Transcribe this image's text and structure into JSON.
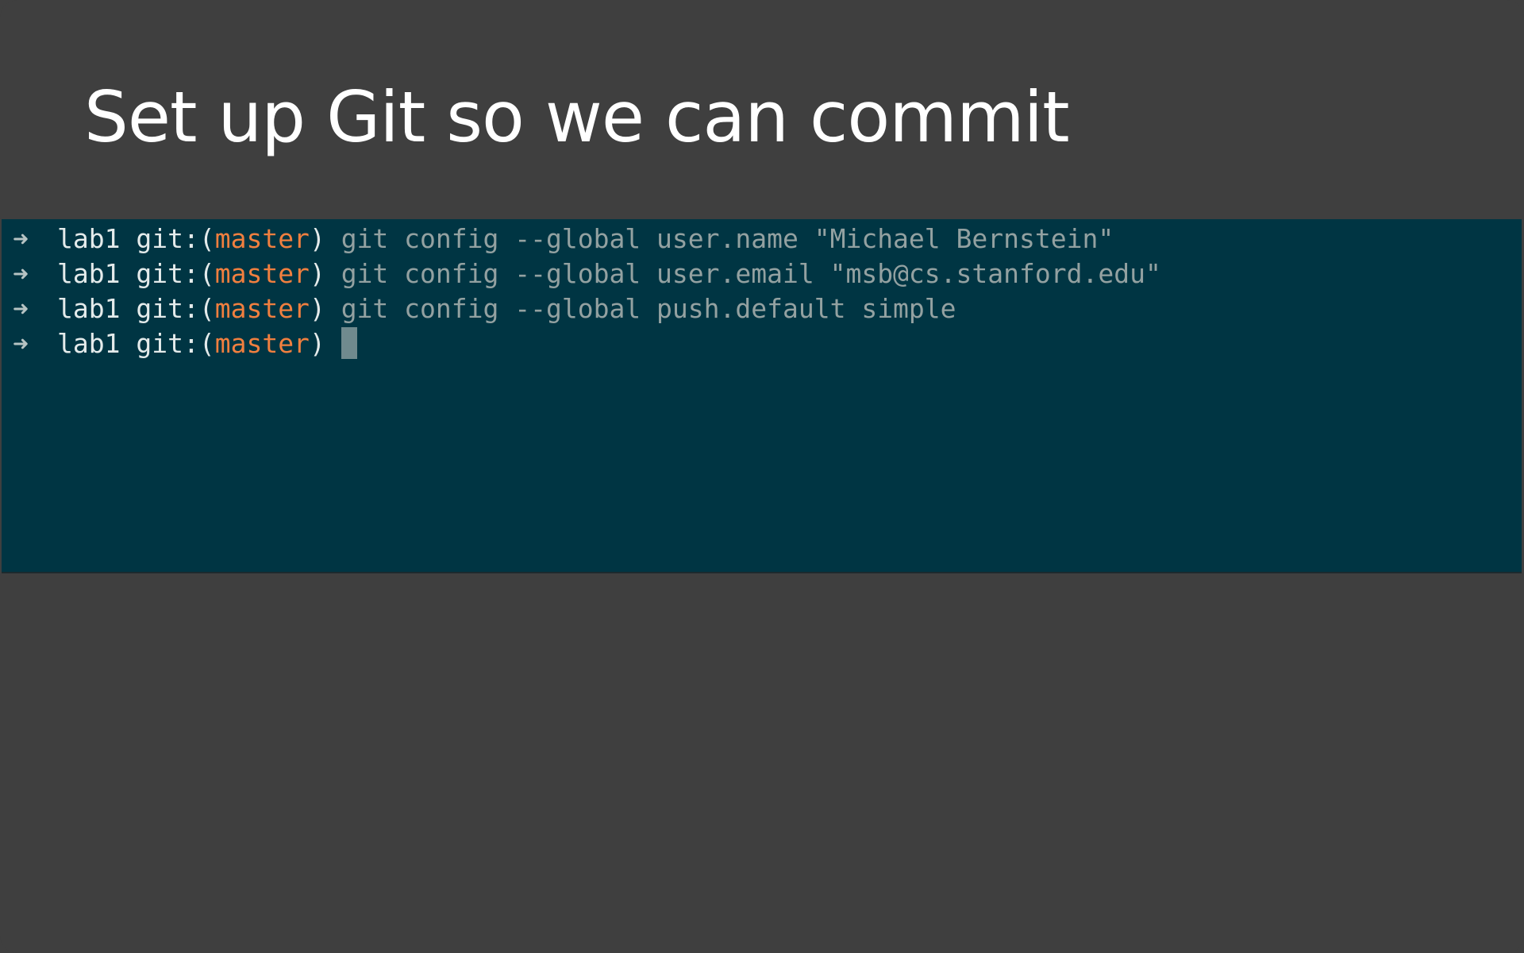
{
  "slide": {
    "title": "Set up Git so we can commit"
  },
  "terminal": {
    "prompt_symbol": "➜",
    "directory": "lab1",
    "git_label": "git:",
    "branch": "master",
    "lines": [
      {
        "command": "git config --global user.name \"Michael Bernstein\""
      },
      {
        "command": "git config --global user.email \"msb@cs.stanford.edu\""
      },
      {
        "command": "git config --global push.default simple"
      },
      {
        "command": ""
      }
    ]
  },
  "colors": {
    "slide_background": "#3f3f3f",
    "terminal_background": "#003543",
    "branch_accent": "#f07f3f",
    "command_text": "#93a1a1"
  }
}
